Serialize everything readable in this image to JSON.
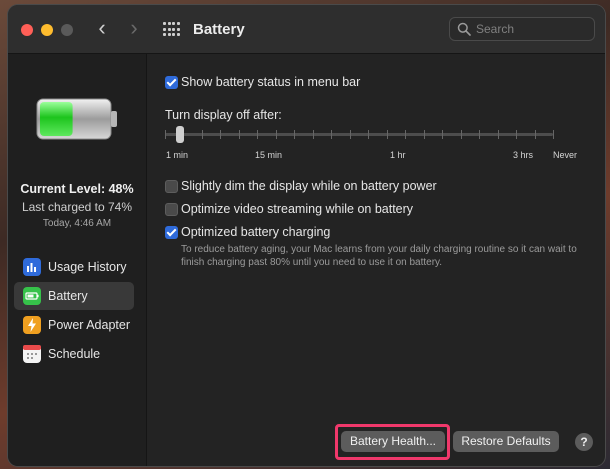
{
  "window": {
    "title": "Battery"
  },
  "toolbar": {
    "back_glyph": "‹",
    "forward_glyph": "›"
  },
  "search": {
    "placeholder": "Search",
    "value": ""
  },
  "sidebar": {
    "current_level": "Current Level: 48%",
    "last_charged": "Last charged to 74%",
    "charged_time": "Today, 4:46 AM",
    "battery_level_percent": 48,
    "items": [
      {
        "label": "Usage History",
        "icon": "bar-chart-icon",
        "color": "#2f6bdb",
        "active": false
      },
      {
        "label": "Battery",
        "icon": "battery-icon",
        "color": "#36c24a",
        "active": true
      },
      {
        "label": "Power Adapter",
        "icon": "bolt-icon",
        "color": "#f0a020",
        "active": false
      },
      {
        "label": "Schedule",
        "icon": "calendar-icon",
        "color": "#e94b4b",
        "active": false
      }
    ]
  },
  "options": {
    "show_status": {
      "label": "Show battery status in menu bar",
      "checked": true
    },
    "turn_display_label": "Turn display off after:",
    "slider": {
      "labels": [
        "1 min",
        "15 min",
        "1 hr",
        "3 hrs",
        "Never"
      ],
      "value": "1 min"
    },
    "dim_display": {
      "label": "Slightly dim the display while on battery power",
      "checked": false
    },
    "optimize_video": {
      "label": "Optimize video streaming while on battery",
      "checked": false
    },
    "optimized_charging": {
      "label": "Optimized battery charging",
      "checked": true,
      "description": "To reduce battery aging, your Mac learns from your daily charging routine so it can wait to finish charging past 80% until you need to use it on battery."
    }
  },
  "buttons": {
    "battery_health": "Battery Health...",
    "restore_defaults": "Restore Defaults",
    "help": "?"
  },
  "colors": {
    "accent": "#2f6bdb",
    "highlight": "#f0386b",
    "battery_green": "#2fd33a"
  }
}
